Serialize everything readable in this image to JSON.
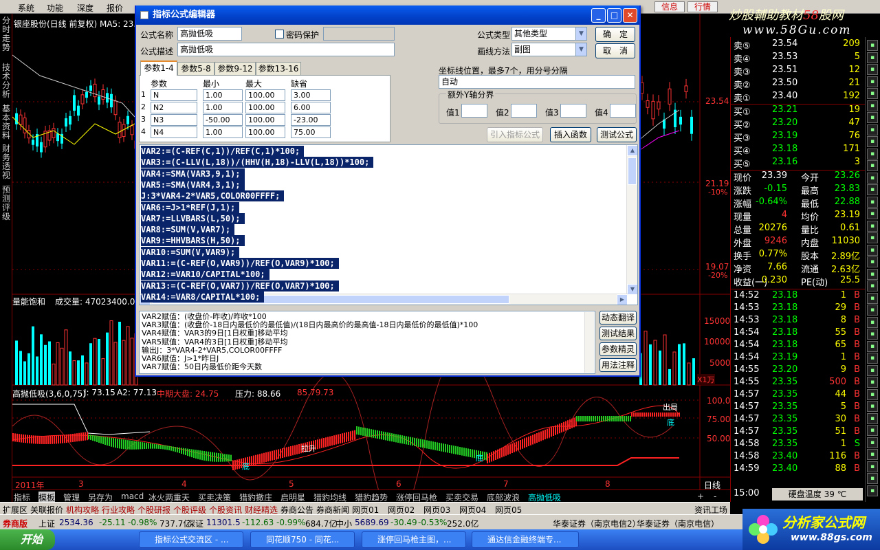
{
  "menu": {
    "items": [
      "系统",
      "功能",
      "深度",
      "报价"
    ],
    "right_buttons": [
      "信息",
      "行情"
    ]
  },
  "brand": {
    "line1_prefix": "炒股輔助教材",
    "line1_accent": "58",
    "line1_suffix": "股网",
    "url": "www.58Gu.com"
  },
  "left_tabs": [
    "分时走势",
    "技术分析",
    "基本资料",
    "财务透视",
    "预测评级"
  ],
  "chart": {
    "stock_title": "银座股份(日线 前复权) MA5: 23.7",
    "price_levels": [
      {
        "value": "23.54",
        "pct": ""
      },
      {
        "value": "21.19",
        "pct": "-10%"
      },
      {
        "value": "19.07",
        "pct": "-20%"
      }
    ],
    "volume_label": "量能饱和",
    "volume_value": "成交量: 47023400.00",
    "volume_levels": [
      "15000",
      "10000",
      "5000"
    ],
    "volume_unit": "X1万",
    "ind_title": "高抛低吸(3,6,0,75)",
    "ind_J": "J: 73.15",
    "ind_A2": "A2: 77.13",
    "ind_mid": "中期大盘: 24.75",
    "ind_press": "压力: 88.66",
    "ind_extra": "85.79.73",
    "ind_levels": [
      "100.0",
      "75.00",
      "50.00"
    ],
    "ind_marks": [
      "底",
      "拉升",
      "底",
      "底",
      "出局"
    ],
    "xaxis": [
      "2011年",
      "3",
      "4",
      "5",
      "6",
      "7",
      "8"
    ],
    "right_label": "日线"
  },
  "quote": {
    "asks": [
      {
        "label": "卖⑤",
        "price": "23.54",
        "vol": "209"
      },
      {
        "label": "卖④",
        "price": "23.53",
        "vol": "5"
      },
      {
        "label": "卖③",
        "price": "23.51",
        "vol": "12"
      },
      {
        "label": "卖②",
        "price": "23.50",
        "vol": "21"
      },
      {
        "label": "卖①",
        "price": "23.40",
        "vol": "192"
      }
    ],
    "bids": [
      {
        "label": "买①",
        "price": "23.21",
        "vol": "19"
      },
      {
        "label": "买②",
        "price": "23.20",
        "vol": "47"
      },
      {
        "label": "买③",
        "price": "23.19",
        "vol": "76"
      },
      {
        "label": "买④",
        "price": "23.18",
        "vol": "171"
      },
      {
        "label": "买⑤",
        "price": "23.16",
        "vol": "3"
      }
    ],
    "stats": [
      {
        "k1": "现价",
        "v1": "23.39",
        "k2": "今开",
        "v2": "23.26"
      },
      {
        "k1": "涨跌",
        "v1": "-0.15",
        "k2": "最高",
        "v2": "23.83"
      },
      {
        "k1": "涨幅",
        "v1": "-0.64%",
        "k2": "最低",
        "v2": "22.88"
      },
      {
        "k1": "现量",
        "v1": "4",
        "k2": "均价",
        "v2": "23.19"
      },
      {
        "k1": "总量",
        "v1": "20276",
        "k2": "量比",
        "v2": "0.61"
      },
      {
        "k1": "外盘",
        "v1": "9246",
        "k2": "内盘",
        "v2": "11030"
      },
      {
        "k1": "换手",
        "v1": "0.77%",
        "k2": "股本",
        "v2": "2.89亿"
      },
      {
        "k1": "净资",
        "v1": "7.66",
        "k2": "流通",
        "v2": "2.63亿"
      },
      {
        "k1": "收益(一)",
        "v1": "0.230",
        "k2": "PE(动)",
        "v2": "25.5"
      }
    ],
    "ticks": [
      {
        "t": "14:52",
        "p": "23.18",
        "v": "1",
        "s": "B"
      },
      {
        "t": "14:53",
        "p": "23.18",
        "v": "29",
        "s": "B"
      },
      {
        "t": "14:53",
        "p": "23.18",
        "v": "8",
        "s": "B"
      },
      {
        "t": "14:54",
        "p": "23.18",
        "v": "55",
        "s": "B"
      },
      {
        "t": "14:54",
        "p": "23.18",
        "v": "65",
        "s": "B"
      },
      {
        "t": "14:54",
        "p": "23.19",
        "v": "1",
        "s": "B"
      },
      {
        "t": "14:55",
        "p": "23.20",
        "v": "9",
        "s": "B"
      },
      {
        "t": "14:55",
        "p": "23.35",
        "v": "500",
        "s": "B"
      },
      {
        "t": "14:57",
        "p": "23.35",
        "v": "44",
        "s": "B"
      },
      {
        "t": "14:57",
        "p": "23.35",
        "v": "5",
        "s": "B"
      },
      {
        "t": "14:57",
        "p": "23.35",
        "v": "30",
        "s": "B"
      },
      {
        "t": "14:57",
        "p": "23.35",
        "v": "51",
        "s": "B"
      },
      {
        "t": "14:58",
        "p": "23.35",
        "v": "1",
        "s": "S"
      },
      {
        "t": "14:58",
        "p": "23.40",
        "v": "116",
        "s": "B"
      },
      {
        "t": "14:59",
        "p": "23.40",
        "v": "88",
        "s": "B"
      }
    ],
    "time": "15:00",
    "disk_temp": "硬盘温度 39 ℃"
  },
  "bottom_tabs": [
    "指标",
    "模板",
    "管理",
    "另存为",
    "macd",
    "冰火两重天",
    "买卖决策",
    "猎豹撤庄",
    "启明星",
    "猎豹均线",
    "猎豹趋势",
    "涨停回马枪",
    "买卖交易",
    "底部波浪",
    "高抛低吸"
  ],
  "bottom_tabs_right": [
    "+",
    "-"
  ],
  "bottom_tabs2": [
    "扩展区",
    "关联报价",
    "机构攻略",
    "行业攻略",
    "个股研报",
    "个股评级",
    "个股资讯",
    "财经精选",
    "券商公告",
    "券商新闻",
    "网页01",
    "网页02",
    "网页03",
    "网页04",
    "网页05"
  ],
  "bottom_tabs2_right": "资讯工场",
  "statusbar": {
    "broker": "券商版",
    "sh_label": "上证",
    "sh": "2534.36",
    "sh_chg": "-25.11",
    "sh_pct": "-0.98%",
    "sh_amt": "737.7亿",
    "sz_label": "深证",
    "sz": "11301.5",
    "sz_chg": "-112.63",
    "sz_pct": "-0.99%",
    "sz_amt": "684.7亿",
    "zx_label": "中小",
    "zx": "5689.69",
    "zx_chg": "-30.49",
    "zx_pct": "-0.53%",
    "zx_amt": "252.0亿",
    "server1": "华泰证券（南京电信2）",
    "server2": "华泰证券（南京电信）"
  },
  "taskbar": {
    "start": "开始",
    "items": [
      "指标公式交流区 - ...",
      "同花顺750 - 同花...",
      "涨停回马枪主图，...",
      "通达信金融终端专..."
    ]
  },
  "logo2": {
    "title": "分析家公式网",
    "url": "www.88gs.com"
  },
  "dialog": {
    "title": "指标公式编辑器",
    "name_label": "公式名称",
    "name_value": "高抛低吸",
    "pwd_label": "密码保护",
    "desc_label": "公式描述",
    "desc_value": "高抛低吸",
    "type_label": "公式类型",
    "type_value": "其他类型",
    "draw_label": "画线方法",
    "draw_value": "副图",
    "ok": "确　定",
    "cancel": "取　消",
    "param_tabs": [
      "参数1-4",
      "参数5-8",
      "参数9-12",
      "参数13-16"
    ],
    "param_headers": [
      "参数",
      "最小",
      "最大",
      "缺省"
    ],
    "params": [
      {
        "n": "1",
        "name": "N",
        "min": "1.00",
        "max": "100.00",
        "def": "3.00"
      },
      {
        "n": "2",
        "name": "N2",
        "min": "1.00",
        "max": "100.00",
        "def": "6.00"
      },
      {
        "n": "3",
        "name": "N3",
        "min": "-50.00",
        "max": "100.00",
        "def": "-23.00"
      },
      {
        "n": "4",
        "name": "N4",
        "min": "1.00",
        "max": "100.00",
        "def": "75.00"
      }
    ],
    "coord_label": "坐标线位置，最多7个，用分号分隔",
    "coord_value": "自动",
    "extra_label": "额外Y轴分界",
    "extra_vals": [
      "值1",
      "值2",
      "值3",
      "值4"
    ],
    "btn_import": "引入指标公式",
    "btn_insert": "插入函数",
    "btn_test": "测试公式",
    "code": [
      "VAR2:=(C-REF(C,1))/REF(C,1)*100;",
      "VAR3:=(C-LLV(L,18))/(HHV(H,18)-LLV(L,18))*100;",
      "VAR4:=SMA(VAR3,9,1);",
      "VAR5:=SMA(VAR4,3,1);",
      "J:3*VAR4-2*VAR5,COLOR00FFFF;",
      "VAR6:=J>1*REF(J,1);",
      "VAR7:=LLVBARS(L,50);",
      "VAR8:=SUM(V,VAR7);",
      "VAR9:=HHVBARS(H,50);",
      "VAR10:=SUM(V,VAR9);",
      "VAR11:=(C-REF(O,VAR9))/REF(O,VAR9)*100;",
      "VAR12:=VAR10/CAPITAL*100;",
      "VAR13:=(C-REF(O,VAR7))/REF(O,VAR7)*100;",
      "VAR14:=VAR8/CAPITAL*100;"
    ],
    "explain": [
      "VAR2赋值：(收盘价-昨收)/昨收*100",
      "VAR3赋值：(收盘价-18日内最低价的最低值)/(18日内最高价的最高值-18日内最低价的最低值)*100",
      "VAR4赋值：VAR3的9日[1日权重]移动平均",
      "VAR5赋值：VAR4的3日[1日权重]移动平均",
      "输出J：3*VAR4-2*VAR5,COLOR00FFFF",
      "VAR6赋值：J>1*昨日J",
      "VAR7赋值：50日内最低价距今天数"
    ],
    "side_btns": [
      "动态翻译",
      "测试结果",
      "参数精灵",
      "用法注释"
    ]
  }
}
